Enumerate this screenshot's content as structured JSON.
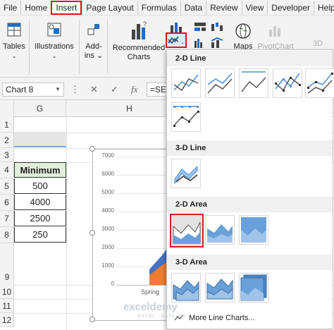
{
  "menu": {
    "tabs": [
      {
        "label": "File"
      },
      {
        "label": "Home"
      },
      {
        "label": "Insert"
      },
      {
        "label": "Page Layout"
      },
      {
        "label": "Formulas"
      },
      {
        "label": "Data"
      },
      {
        "label": "Review"
      },
      {
        "label": "View"
      },
      {
        "label": "Developer"
      },
      {
        "label": "Help"
      }
    ],
    "active_tab": "Insert",
    "highlight_color": "#e0141f"
  },
  "ribbon": {
    "tables_label": "Tables",
    "illustrations_label": "Illustrations",
    "addins_label_1": "Add-",
    "addins_label_2": "ins",
    "recommended_label_1": "Recommended",
    "recommended_label_2": "Charts",
    "maps_label": "Maps",
    "pivotchart_label": "PivotChart",
    "threed_label": "3D",
    "accent_color": "#1e6fc4"
  },
  "formula_bar": {
    "name_box": "Chart 8",
    "cancel_glyph": "✕",
    "enter_glyph": "✓",
    "fx_glyph": "fx",
    "formula": "=SE"
  },
  "grid": {
    "columns": [
      "G",
      "H"
    ],
    "rows": [
      "1",
      "2",
      "3",
      "4",
      "5",
      "6",
      "7",
      "8",
      "9",
      "10",
      "11",
      "12"
    ],
    "header_cell": "Minimum",
    "values": [
      "500",
      "4000",
      "2500",
      "250"
    ],
    "header_fill": "#e2efda"
  },
  "chart": {
    "y_ticks": [
      "7000",
      "6000",
      "5000",
      "4000",
      "3000",
      "2000",
      "1000",
      "0"
    ],
    "x_label": "Spring",
    "series_colors": [
      "#4472c4",
      "#ed7d31"
    ]
  },
  "dropdown": {
    "sections": {
      "line2d": "2-D Line",
      "line3d": "3-D Line",
      "area2d": "2-D Area",
      "area3d": "3-D Area"
    },
    "more_label": "More Line Charts...",
    "selected_color": "#d22027"
  },
  "watermark": {
    "brand": "exceldemy",
    "tagline": "EXCEL · DATA · BI"
  }
}
